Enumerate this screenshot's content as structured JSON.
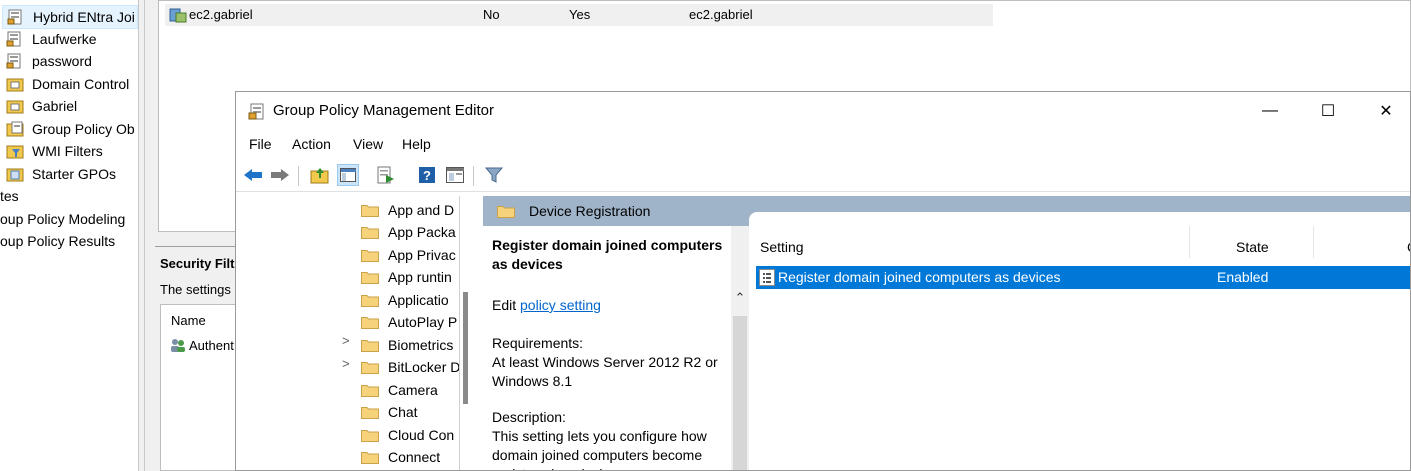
{
  "bg_window": {
    "tree_items": [
      {
        "label": "Hybrid ENtra Joi",
        "icon": "gpo-link-icon",
        "selected": true
      },
      {
        "label": "Laufwerke",
        "icon": "gpo-link-icon"
      },
      {
        "label": "password",
        "icon": "gpo-link-icon"
      },
      {
        "label": "Domain Control",
        "icon": "ou-icon"
      },
      {
        "label": "Gabriel",
        "icon": "ou-icon"
      },
      {
        "label": "Group Policy Ob",
        "icon": "gpo-container-icon"
      },
      {
        "label": "WMI Filters",
        "icon": "wmi-icon"
      },
      {
        "label": "Starter GPOs",
        "icon": "starter-gpo-icon"
      },
      {
        "label": "tes"
      },
      {
        "label": "oup Policy Modeling"
      },
      {
        "label": "oup Policy Results"
      }
    ],
    "top_list_row": {
      "name": "ec2.gabriel",
      "col2": "No",
      "col3": "Yes",
      "col4": "ec2.gabriel"
    },
    "security_filtering": {
      "title": "Security Filt",
      "desc": "The settings",
      "col_header": "Name",
      "item": "Authent"
    }
  },
  "editor": {
    "title": "Group Policy Management Editor",
    "window_controls": {
      "minimize": "—",
      "maximize": "☐",
      "close": "✕"
    },
    "menu": [
      "File",
      "Action",
      "View",
      "Help"
    ],
    "toolbar_icons": [
      "back-arrow-icon",
      "forward-arrow-icon",
      "up-folder-icon",
      "show-hide-tree-icon",
      "export-list-icon",
      "help-icon",
      "extended-view-icon",
      "filter-icon"
    ],
    "tree_items": [
      "App and D",
      "App Packa",
      "App Privac",
      "App runtin",
      "Applicatio",
      "AutoPlay P",
      "Biometrics",
      "BitLocker D",
      "Camera",
      "Chat",
      "Cloud Con",
      "Connect"
    ],
    "expandable": [
      "Biometrics",
      "BitLocker D"
    ],
    "folder_header": "Device Registration",
    "description": {
      "title": "Register domain joined computers as devices",
      "edit_prefix": "Edit ",
      "edit_link": "policy setting",
      "requirements_label": "Requirements:",
      "requirements_text": "At least Windows Server 2012 R2 or Windows 8.1",
      "description_label": "Description:",
      "description_text": "This setting lets you configure how domain joined computers become registered as devices"
    },
    "columns": {
      "setting": "Setting",
      "state": "State",
      "comment": "C"
    },
    "rows": [
      {
        "setting": "Register domain joined computers as devices",
        "state": "Enabled",
        "selected": true
      }
    ],
    "colors": {
      "selection": "#0078d7",
      "header_bar": "#9fb4c8",
      "link": "#0066cc"
    }
  }
}
